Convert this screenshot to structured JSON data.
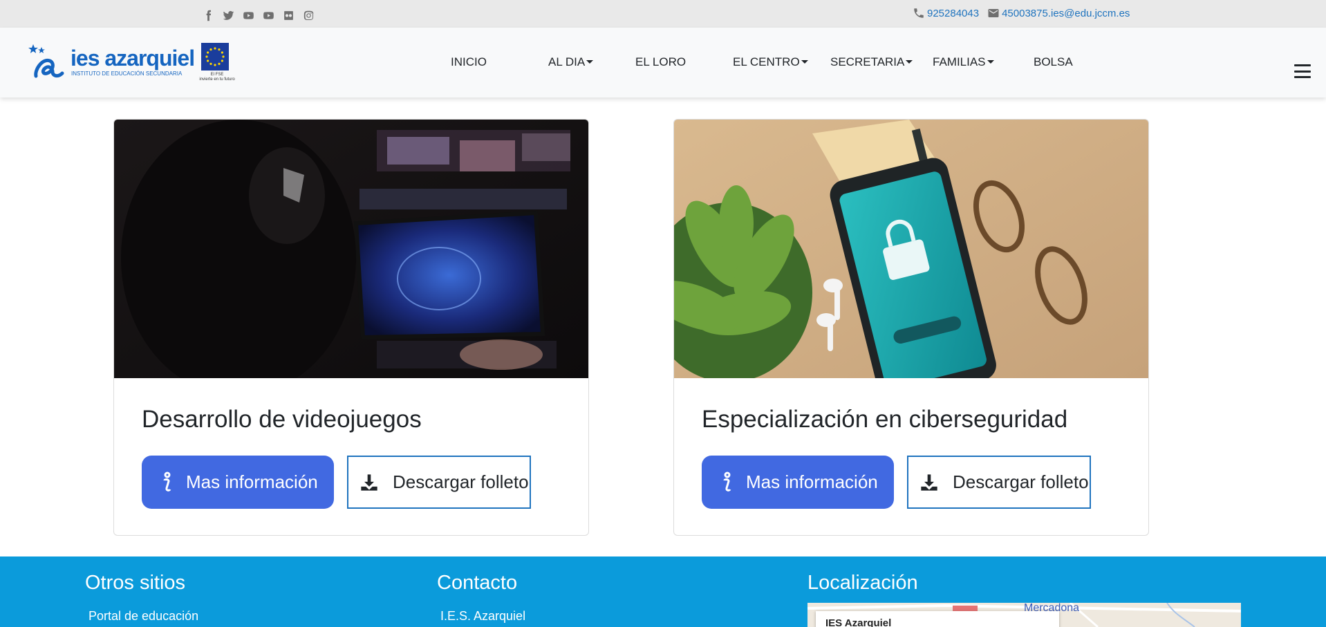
{
  "topbar": {
    "social_icons": [
      "facebook-icon",
      "twitter-icon",
      "youtube-icon",
      "youtube-icon",
      "flickr-icon",
      "instagram-icon"
    ],
    "phone": "925284043",
    "email": "45003875.ies@edu.jccm.es"
  },
  "brand": {
    "name": "ies azarquiel",
    "subtitle": "INSTITUTO DE EDUCACIÓN SECUNDARIA",
    "eu_caption_1": "El FSE",
    "eu_caption_2": "invierte en tu futuro"
  },
  "nav": {
    "items": [
      {
        "label": "INICIO",
        "dropdown": false
      },
      {
        "label": "AL DIA",
        "dropdown": true
      },
      {
        "label": "EL LORO",
        "dropdown": false
      },
      {
        "label": "EL CENTRO",
        "dropdown": true
      },
      {
        "label": "SECRETARIA",
        "dropdown": true
      },
      {
        "label": "FAMILIAS",
        "dropdown": true
      },
      {
        "label": "BOLSA",
        "dropdown": false
      }
    ]
  },
  "cards": [
    {
      "title": "Desarrollo de videojuegos",
      "info_label": "Mas información",
      "download_label": "Descargar folleto"
    },
    {
      "title": "Especialización en ciberseguridad",
      "info_label": "Mas información",
      "download_label": "Descargar folleto"
    }
  ],
  "footer": {
    "otros_title": "Otros sitios",
    "otros_link": "Portal de educación",
    "contacto_title": "Contacto",
    "contacto_line": "I.E.S. Azarquiel",
    "loc_title": "Localización",
    "map_place": "IES Azarquiel",
    "map_label": "Mercadona"
  },
  "colors": {
    "primary_button": "#4169e1",
    "footer_bg": "#0b9bdb",
    "link": "#1e73be"
  }
}
